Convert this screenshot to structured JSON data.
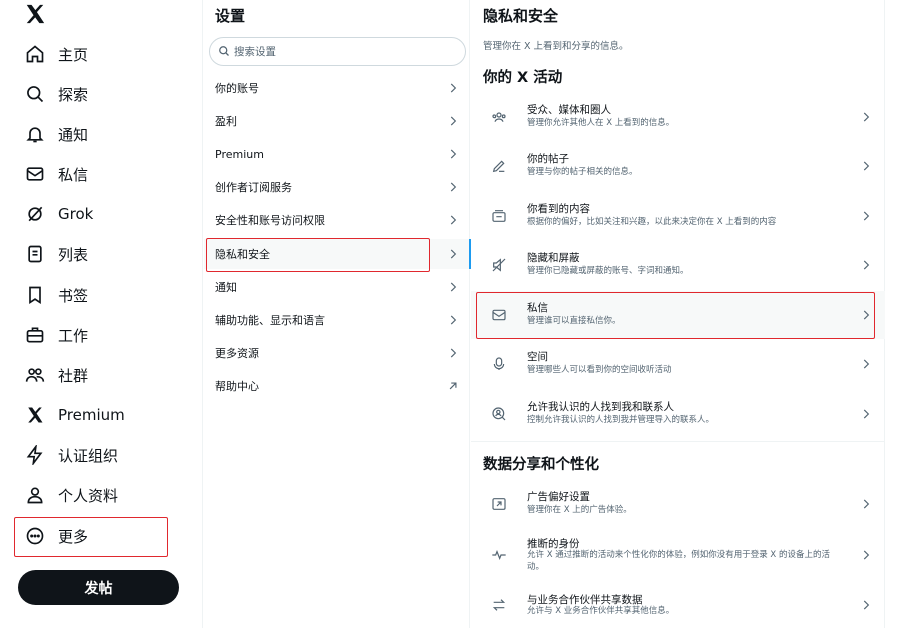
{
  "nav": {
    "items": [
      {
        "label": "主页",
        "icon": "home-icon"
      },
      {
        "label": "探索",
        "icon": "search-icon"
      },
      {
        "label": "通知",
        "icon": "bell-icon"
      },
      {
        "label": "私信",
        "icon": "mail-icon"
      },
      {
        "label": "Grok",
        "icon": "grok-icon"
      },
      {
        "label": "列表",
        "icon": "list-icon"
      },
      {
        "label": "书签",
        "icon": "bookmark-icon"
      },
      {
        "label": "工作",
        "icon": "briefcase-icon"
      },
      {
        "label": "社群",
        "icon": "communities-icon"
      },
      {
        "label": "Premium",
        "icon": "x-logo-icon"
      },
      {
        "label": "认证组织",
        "icon": "lightning-icon"
      },
      {
        "label": "个人资料",
        "icon": "person-icon"
      },
      {
        "label": "更多",
        "icon": "more-circle-icon"
      }
    ],
    "post_button": "发帖"
  },
  "settings": {
    "title": "设置",
    "search_placeholder": "搜索设置",
    "items": [
      {
        "label": "你的账号"
      },
      {
        "label": "盈利"
      },
      {
        "label": "Premium"
      },
      {
        "label": "创作者订阅服务"
      },
      {
        "label": "安全性和账号访问权限"
      },
      {
        "label": "隐私和安全"
      },
      {
        "label": "通知"
      },
      {
        "label": "辅助功能、显示和语言"
      },
      {
        "label": "更多资源"
      },
      {
        "label": "帮助中心"
      }
    ]
  },
  "privacy": {
    "title": "隐私和安全",
    "subtitle": "管理你在 X 上看到和分享的信息。",
    "section1": "你的 X 活动",
    "section2": "数据分享和个性化",
    "activity": [
      {
        "title": "受众、媒体和圈人",
        "desc": "管理你允许其他人在 X 上看到的信息。",
        "icon": "people-icon"
      },
      {
        "title": "你的帖子",
        "desc": "管理与你的帖子相关的信息。",
        "icon": "pencil-icon"
      },
      {
        "title": "你看到的内容",
        "desc": "根据你的偏好，比如关注和兴趣，以此来决定你在 X 上看到的内容",
        "icon": "content-icon"
      },
      {
        "title": "隐藏和屏蔽",
        "desc": "管理你已隐藏或屏蔽的账号、字词和通知。",
        "icon": "mute-icon"
      },
      {
        "title": "私信",
        "desc": "管理谁可以直接私信你。",
        "icon": "mail-icon"
      },
      {
        "title": "空间",
        "desc": "管理哪些人可以看到你的空间收听活动",
        "icon": "mic-icon"
      },
      {
        "title": "允许我认识的人找到我和联系人",
        "desc": "控制允许我认识的人找到我并管理导入的联系人。",
        "icon": "discover-icon"
      }
    ],
    "data": [
      {
        "title": "广告偏好设置",
        "desc": "管理你在 X 上的广告体验。",
        "icon": "ad-icon"
      },
      {
        "title": "推断的身份",
        "desc": "允许 X 通过推断的活动来个性化你的体验，例如你没有用于登录 X 的设备上的活",
        "desc2": "动。",
        "icon": "pulse-icon"
      },
      {
        "title": "与业务合作伙伴共享数据",
        "desc": "允许与 X 业务合作伙伴共享其他信息。",
        "icon": "swap-icon"
      }
    ]
  }
}
